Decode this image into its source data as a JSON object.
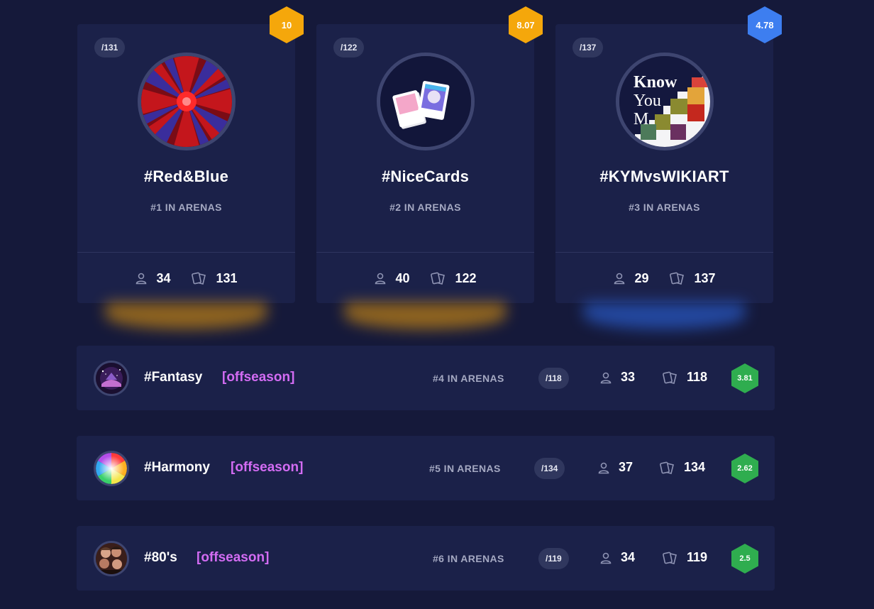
{
  "top_cards": [
    {
      "count_pill": "/131",
      "title": "#Red&Blue",
      "rank": "#1 IN ARENAS",
      "members": "34",
      "cards": "131",
      "score": "10",
      "score_color": "#f5a70b",
      "glow_color": "#f2a10a"
    },
    {
      "count_pill": "/122",
      "title": "#NiceCards",
      "rank": "#2 IN ARENAS",
      "members": "40",
      "cards": "122",
      "score": "8.07",
      "score_color": "#f5a70b",
      "glow_color": "#f2a10a"
    },
    {
      "count_pill": "/137",
      "title": "#KYMvsWIKIART",
      "rank": "#3 IN ARENAS",
      "members": "29",
      "cards": "137",
      "score": "4.78",
      "score_color": "#3d7ef0",
      "glow_color": "#2f6ef2"
    }
  ],
  "rows": [
    {
      "title": "#Fantasy",
      "status": "[offseason]",
      "rank": "#4 IN ARENAS",
      "count_pill": "/118",
      "members": "33",
      "cards": "118",
      "score": "3.81",
      "score_color": "#2fad4f"
    },
    {
      "title": "#Harmony",
      "status": "[offseason]",
      "rank": "#5 IN ARENAS",
      "count_pill": "/134",
      "members": "37",
      "cards": "134",
      "score": "2.62",
      "score_color": "#2fad4f"
    },
    {
      "title": "#80's",
      "status": "[offseason]",
      "rank": "#6 IN ARENAS",
      "count_pill": "/119",
      "members": "34",
      "cards": "119",
      "score": "2.5",
      "score_color": "#2fad4f"
    }
  ],
  "avatar_texts": {
    "kym_line1": "Know",
    "kym_line2": "You",
    "kym_line3": "M"
  }
}
